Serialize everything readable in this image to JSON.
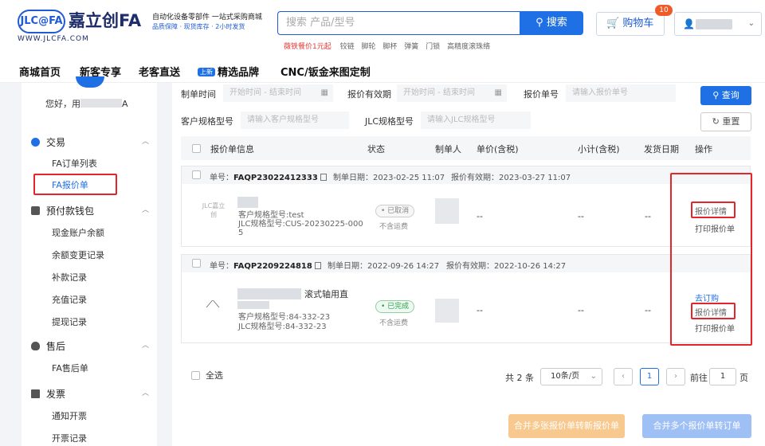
{
  "header": {
    "logo_badge": "JLC@FA",
    "logo_name": "嘉立创FA",
    "logo_url": "WWW.JLCFA.COM",
    "slogan_main": "自动化设备零部件 一站式采购商城",
    "slogan_sub": "品质保障 · 现货库存 · 2小时发货",
    "search_placeholder": "搜索 产品/型号",
    "search_button": "搜索",
    "hot_word_promo": "薇铁餐价1元起",
    "hot_words": [
      "铰链",
      "脚轮",
      "脚杯",
      "弹簧",
      "门锁",
      "高精度滚珠络"
    ],
    "cart_label": "购物车",
    "cart_count": "10"
  },
  "nav": [
    "商城首页",
    "新客专享",
    "老客直送",
    "精选品牌",
    "CNC/钣金来图定制"
  ],
  "nav_badge": "上新",
  "sidebar": {
    "greeting_prefix": "您好，用",
    "greeting_suffix": "A",
    "sections": [
      {
        "label": "交易",
        "items": [
          "FA订单列表",
          "FA报价单"
        ]
      },
      {
        "label": "预付款钱包",
        "items": [
          "现金账户余额",
          "余额变更记录",
          "补款记录",
          "充值记录",
          "提现记录"
        ]
      },
      {
        "label": "售后",
        "items": [
          "FA售后单"
        ]
      },
      {
        "label": "发票",
        "items": [
          "通知开票",
          "开票记录"
        ]
      }
    ]
  },
  "filters": {
    "create_time_label": "制单时间",
    "create_time_placeholder": "开始时间 - 结束时间",
    "valid_label": "报价有效期",
    "valid_placeholder": "开始时间 - 结束时间",
    "quote_no_label": "报价单号",
    "quote_no_placeholder": "请输入报价单号",
    "cust_spec_label": "客户规格型号",
    "cust_spec_placeholder": "请输入客户规格型号",
    "jlc_spec_label": "JLC规格型号",
    "jlc_spec_placeholder": "请输入JLC规格型号",
    "query_button": "查询",
    "reset_button": "重置"
  },
  "table_headers": [
    "报价单信息",
    "状态",
    "制单人",
    "单价(含税)",
    "小计(含税)",
    "发货日期",
    "操作"
  ],
  "orders": [
    {
      "no_label": "单号：",
      "no": "FAQP23022412333",
      "create_date": "制单日期：2023-02-25 11:07",
      "valid_date": "报价有效期：2023-03-27 11:07",
      "thumb": "JLC嘉立创",
      "cust_spec": "客户规格型号:test",
      "jlc_spec_1": "JLC规格型号:CUS-20230225-000",
      "jlc_spec_2": "5",
      "status": "• 已取消",
      "tax": "不含运费",
      "price": "--",
      "subtotal": "--",
      "ship": "--",
      "ops": [
        "报价详情",
        "打印报价单"
      ]
    },
    {
      "no_label": "单号：",
      "no": "FAQP2209224818",
      "create_date": "制单日期：2022-09-26 14:27",
      "valid_date": "报价有效期：2022-10-26 14:27",
      "name_tail": "滚式轴用直",
      "cust_spec": "客户规格型号:84-332-23",
      "jlc_spec_1": "JLC规格型号:84-332-23",
      "status": "• 已完成",
      "tax": "不含运费",
      "price": "--",
      "subtotal": "--",
      "ship": "--",
      "ops": [
        "去订购",
        "报价详情",
        "打印报价单"
      ]
    }
  ],
  "footer": {
    "select_all": "全选",
    "total": "共 2 条",
    "page_size": "10条/页",
    "current_page": "1",
    "goto_prefix": "前往",
    "goto_value": "1",
    "goto_suffix": "页",
    "merge_button": "合并多张报价单转新报价单",
    "to_order_button": "合并多个报价单转订单"
  },
  "colors": {
    "accent": "#1f6fe5",
    "highlight": "#e4262b",
    "orange_btn": "#f7c98e",
    "blue_btn": "#9fc0f4"
  }
}
